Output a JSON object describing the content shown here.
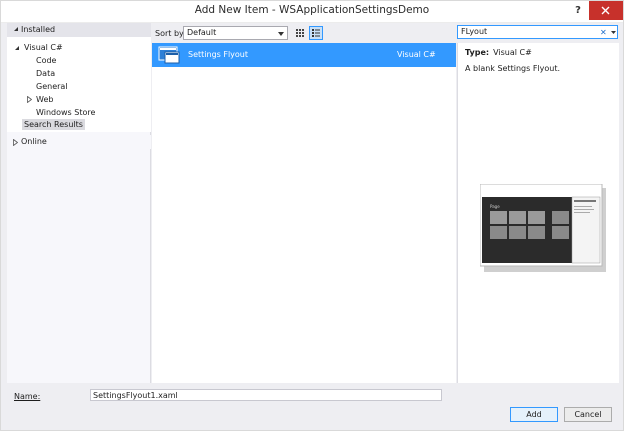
{
  "window": {
    "title": "Add New Item - WSApplicationSettingsDemo",
    "help_label": "?"
  },
  "tree": {
    "installed_label": "Installed",
    "items": [
      {
        "label": "Visual C#"
      },
      {
        "label": "Code"
      },
      {
        "label": "Data"
      },
      {
        "label": "General"
      },
      {
        "label": "Web"
      },
      {
        "label": "Windows Store"
      },
      {
        "label": "Search Results"
      }
    ],
    "online_label": "Online"
  },
  "toolbar": {
    "sort_label": "Sort by:",
    "sort_value": "Default"
  },
  "search": {
    "value": "FLyout"
  },
  "templates": [
    {
      "name": "Settings Flyout",
      "language": "Visual C#"
    }
  ],
  "details": {
    "type_label": "Type:",
    "type_value": "Visual C#",
    "description": "A blank Settings Flyout.",
    "preview_title": "Page"
  },
  "footer": {
    "name_label": "Name:",
    "name_value": "SettingsFlyout1.xaml",
    "add_label": "Add",
    "cancel_label": "Cancel"
  },
  "colors": {
    "accent": "#3399ff",
    "close": "#c7312b",
    "selection": "#dadadf"
  }
}
